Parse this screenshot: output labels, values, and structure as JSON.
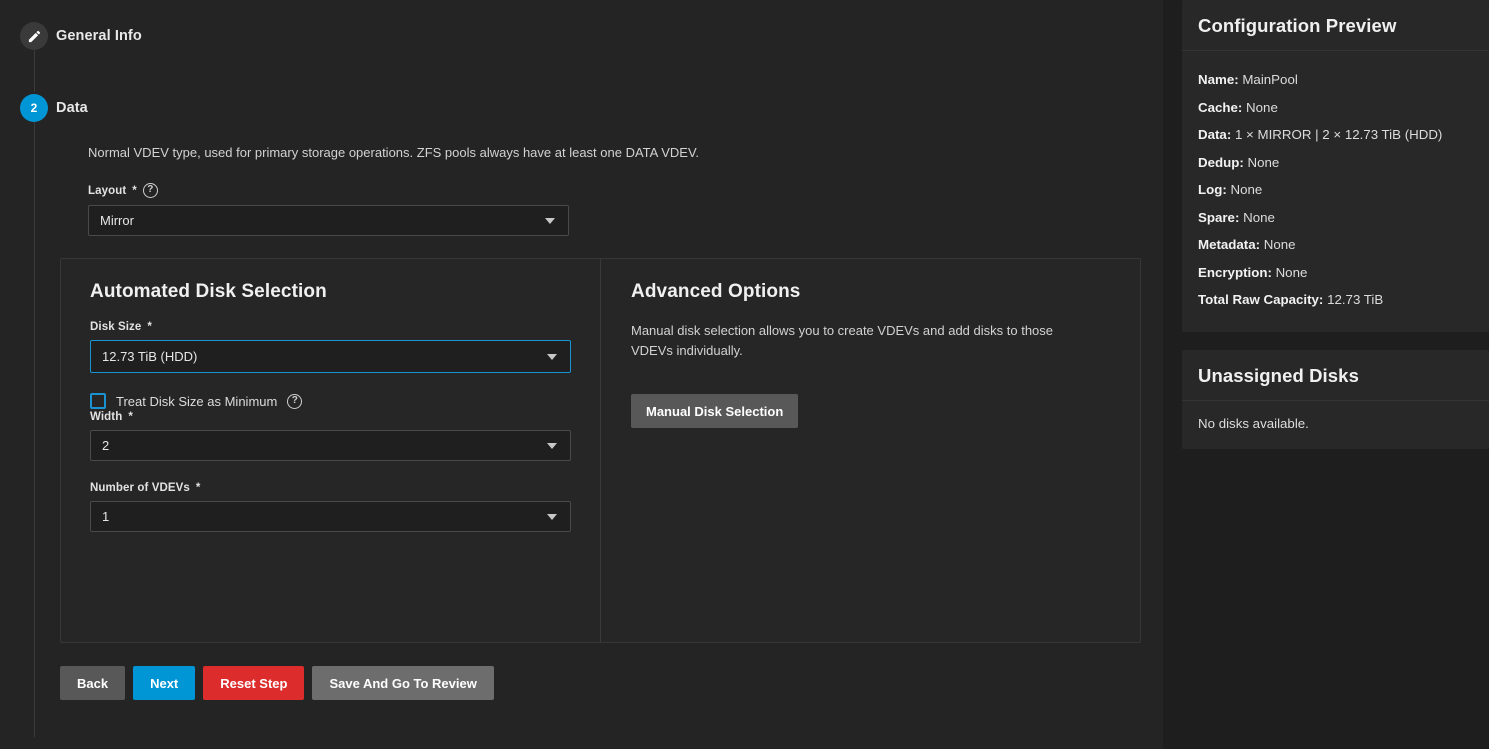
{
  "wizard": {
    "steps": [
      {
        "id": "general-info",
        "label": "General Info",
        "marker": "pencil-icon",
        "state": "completed"
      },
      {
        "id": "data",
        "label": "Data",
        "marker": "2",
        "state": "active"
      }
    ]
  },
  "data_step": {
    "description": "Normal VDEV type, used for primary storage operations. ZFS pools always have at least one DATA VDEV.",
    "layout_field": {
      "label": "Layout",
      "required_mark": "*",
      "help_icon": "help-circle-icon",
      "value": "Mirror"
    }
  },
  "automated_disk_selection": {
    "heading": "Automated Disk Selection",
    "disk_size_field": {
      "label": "Disk Size",
      "required_mark": "*",
      "value": "12.73 TiB (HDD)",
      "focused": true
    },
    "treat_min_checkbox": {
      "label": "Treat Disk Size as Minimum",
      "checked": false,
      "help_icon": "help-circle-icon"
    },
    "width_field": {
      "label": "Width",
      "required_mark": "*",
      "value": "2"
    },
    "vdevs_field": {
      "label": "Number of VDEVs",
      "required_mark": "*",
      "value": "1"
    }
  },
  "advanced_options": {
    "heading": "Advanced Options",
    "description": "Manual disk selection allows you to create VDEVs and add disks to those VDEVs individually.",
    "manual_button_label": "Manual Disk Selection"
  },
  "footer": {
    "back_label": "Back",
    "next_label": "Next",
    "reset_label": "Reset Step",
    "save_review_label": "Save And Go To Review"
  },
  "configuration_preview": {
    "title": "Configuration Preview",
    "rows": [
      {
        "key": "Name:",
        "value": "MainPool"
      },
      {
        "key": "Cache:",
        "value": "None"
      },
      {
        "key": "Data:",
        "value": "1 × MIRROR | 2 × 12.73 TiB (HDD)"
      },
      {
        "key": "Dedup:",
        "value": "None"
      },
      {
        "key": "Log:",
        "value": "None"
      },
      {
        "key": "Spare:",
        "value": "None"
      },
      {
        "key": "Metadata:",
        "value": "None"
      },
      {
        "key": "Encryption:",
        "value": "None"
      },
      {
        "key": "Total Raw Capacity:",
        "value": "12.73 TiB"
      }
    ]
  },
  "unassigned_disks": {
    "title": "Unassigned Disks",
    "empty_message": "No disks available."
  },
  "colors": {
    "accent_blue": "#0095d5",
    "danger_red": "#dd2c2c",
    "page_bg": "#1e1e1e",
    "panel_bg": "#242424",
    "card_bg": "#282828"
  }
}
